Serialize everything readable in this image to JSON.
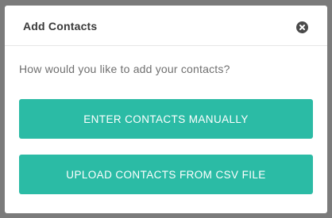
{
  "dialog": {
    "title": "Add Contacts",
    "prompt": "How would you like to add your contacts?",
    "manual_button_label": "ENTER CONTACTS MANUALLY",
    "csv_button_label": "UPLOAD CONTACTS FROM CSV FILE",
    "close_icon": "close-circle-icon"
  },
  "colors": {
    "accent": "#2bbba5",
    "overlay": "#7b7b7b",
    "title_text": "#3a3a3a",
    "prompt_text": "#6f6f6f"
  }
}
